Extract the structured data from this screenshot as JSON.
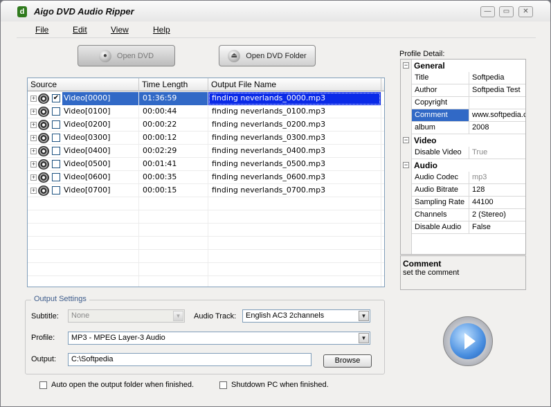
{
  "window": {
    "title": "Aigo DVD Audio Ripper"
  },
  "menu": {
    "items": [
      "File",
      "Edit",
      "View",
      "Help"
    ]
  },
  "toolbar": {
    "open_dvd": "Open DVD",
    "open_dvd_folder": "Open DVD Folder"
  },
  "list": {
    "columns": [
      "Source",
      "Time Length",
      "Output File Name"
    ],
    "rows": [
      {
        "name": "Video[0000]",
        "time": "01:36:59",
        "output": "finding neverlands_0000.mp3",
        "checked": true,
        "selected": true
      },
      {
        "name": "Video[0100]",
        "time": "00:00:44",
        "output": "finding neverlands_0100.mp3",
        "checked": false,
        "selected": false
      },
      {
        "name": "Video[0200]",
        "time": "00:00:22",
        "output": "finding neverlands_0200.mp3",
        "checked": false,
        "selected": false
      },
      {
        "name": "Video[0300]",
        "time": "00:00:12",
        "output": "finding neverlands_0300.mp3",
        "checked": false,
        "selected": false
      },
      {
        "name": "Video[0400]",
        "time": "00:02:29",
        "output": "finding neverlands_0400.mp3",
        "checked": false,
        "selected": false
      },
      {
        "name": "Video[0500]",
        "time": "00:01:41",
        "output": "finding neverlands_0500.mp3",
        "checked": false,
        "selected": false
      },
      {
        "name": "Video[0600]",
        "time": "00:00:35",
        "output": "finding neverlands_0600.mp3",
        "checked": false,
        "selected": false
      },
      {
        "name": "Video[0700]",
        "time": "00:00:15",
        "output": "finding neverlands_0700.mp3",
        "checked": false,
        "selected": false
      }
    ]
  },
  "output_settings": {
    "title": "Output Settings",
    "subtitle_label": "Subtitle:",
    "subtitle_value": "None",
    "audio_track_label": "Audio Track:",
    "audio_track_value": "English AC3 2channels",
    "profile_label": "Profile:",
    "profile_value": "MP3 - MPEG Layer-3 Audio",
    "output_label": "Output:",
    "output_value": "C:\\Softpedia",
    "browse_label": "Browse"
  },
  "options": {
    "auto_open": "Auto open the output folder when finished.",
    "shutdown": "Shutdown PC when finished."
  },
  "profile": {
    "label": "Profile Detail:",
    "general_title": "General",
    "general": [
      {
        "key": "Title",
        "value": "Softpedia"
      },
      {
        "key": "Author",
        "value": "Softpedia Test"
      },
      {
        "key": "Copyright",
        "value": ""
      },
      {
        "key": "Comment",
        "value": "www.softpedia.com"
      },
      {
        "key": "album",
        "value": "2008"
      }
    ],
    "video_title": "Video",
    "video": [
      {
        "key": "Disable Video",
        "value": "True"
      }
    ],
    "audio_title": "Audio",
    "audio": [
      {
        "key": "Audio Codec",
        "value": "mp3"
      },
      {
        "key": "Audio Bitrate",
        "value": "128"
      },
      {
        "key": "Sampling Rate",
        "value": "44100"
      },
      {
        "key": "Channels",
        "value": "2 (Stereo)"
      },
      {
        "key": "Disable Audio",
        "value": "False"
      }
    ],
    "desc_title": "Comment",
    "desc_text": "set the comment"
  }
}
